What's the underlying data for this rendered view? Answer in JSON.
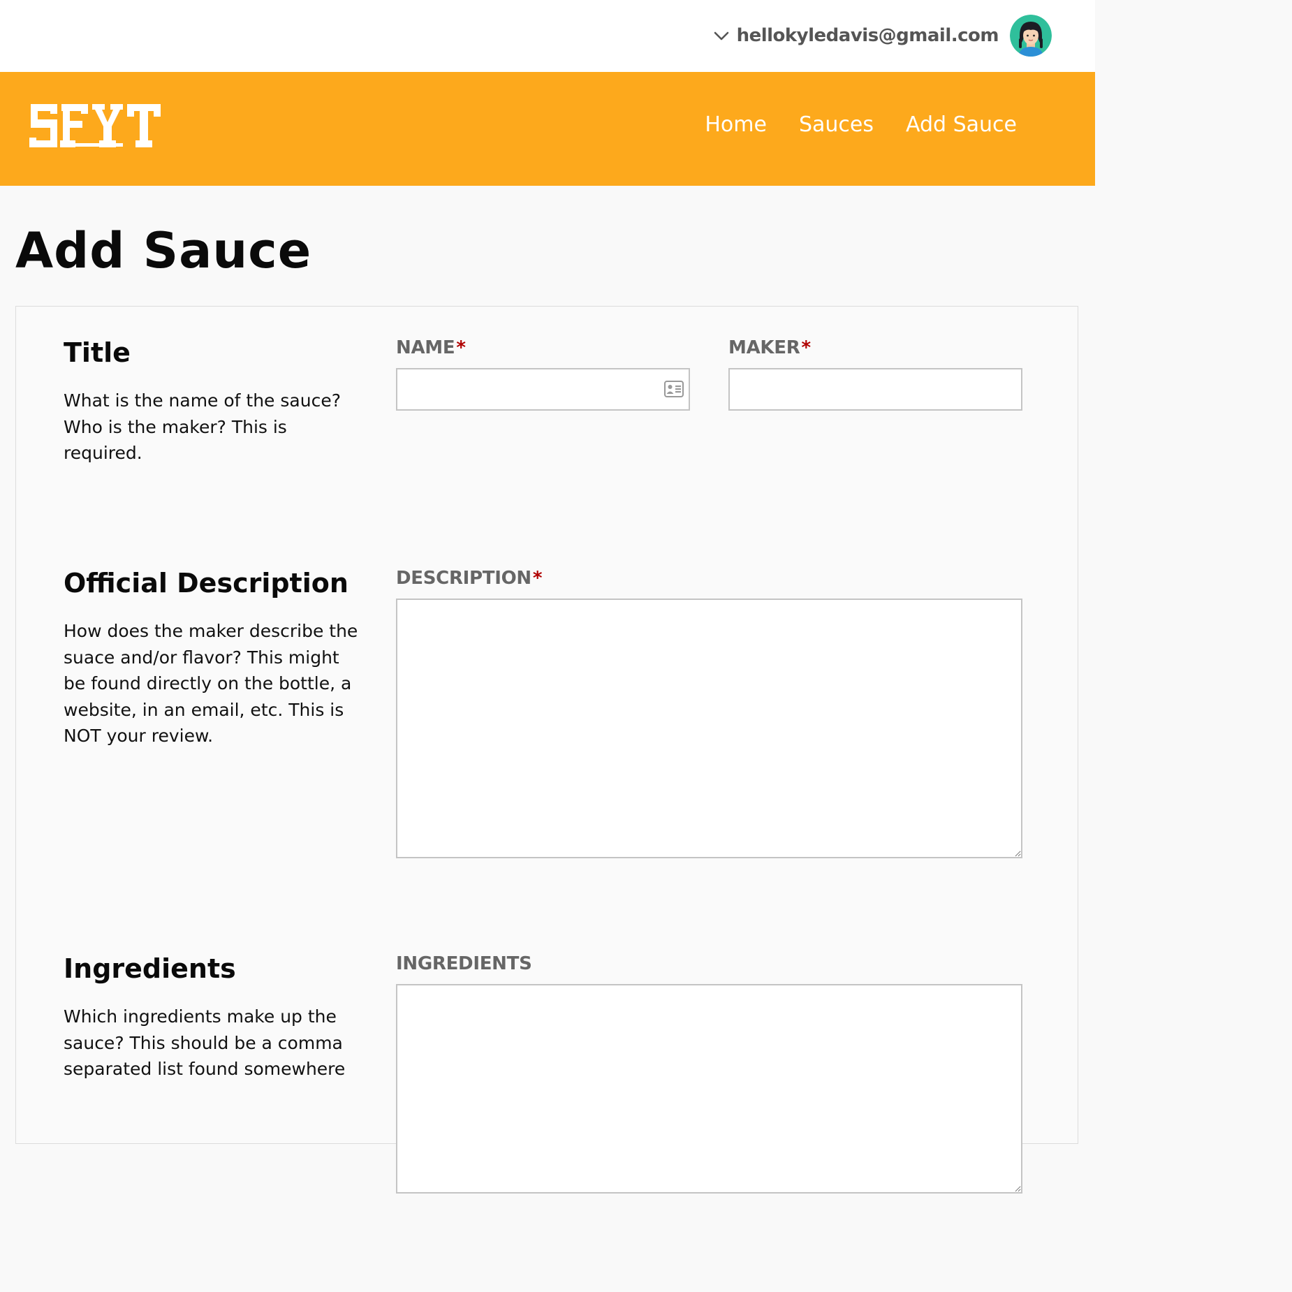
{
  "account": {
    "email": "hellokyledavis@gmail.com",
    "chevron_icon": "chevron-down-icon",
    "avatar_icon": "user-avatar"
  },
  "header": {
    "logo_text": "SFYT",
    "brand_color": "#fda91c",
    "nav": [
      {
        "label": "Home"
      },
      {
        "label": "Sauces"
      },
      {
        "label": "Add Sauce"
      }
    ]
  },
  "page": {
    "title": "Add Sauce"
  },
  "sections": {
    "title": {
      "heading": "Title",
      "help": "What is the name of the sauce? Who is the maker? This is required."
    },
    "description": {
      "heading": "Official Description",
      "help": "How does the maker describe the suace and/or flavor? This might be found directly on the bottle, a website, in an email, etc. This is NOT your review."
    },
    "ingredients": {
      "heading": "Ingredients",
      "help": "Which ingredients make up the sauce? This should be a comma separated list found somewhere"
    }
  },
  "fields": {
    "name": {
      "label": "NAME",
      "required_mark": "*",
      "value": "",
      "icon": "contact-card-icon"
    },
    "maker": {
      "label": "MAKER",
      "required_mark": "*",
      "value": ""
    },
    "description": {
      "label": "DESCRIPTION",
      "required_mark": "*",
      "value": ""
    },
    "ingredients": {
      "label": "INGREDIENTS",
      "value": ""
    }
  },
  "colors": {
    "required": "#b00000",
    "label": "#666666",
    "input_border": "#c4c4c4"
  }
}
